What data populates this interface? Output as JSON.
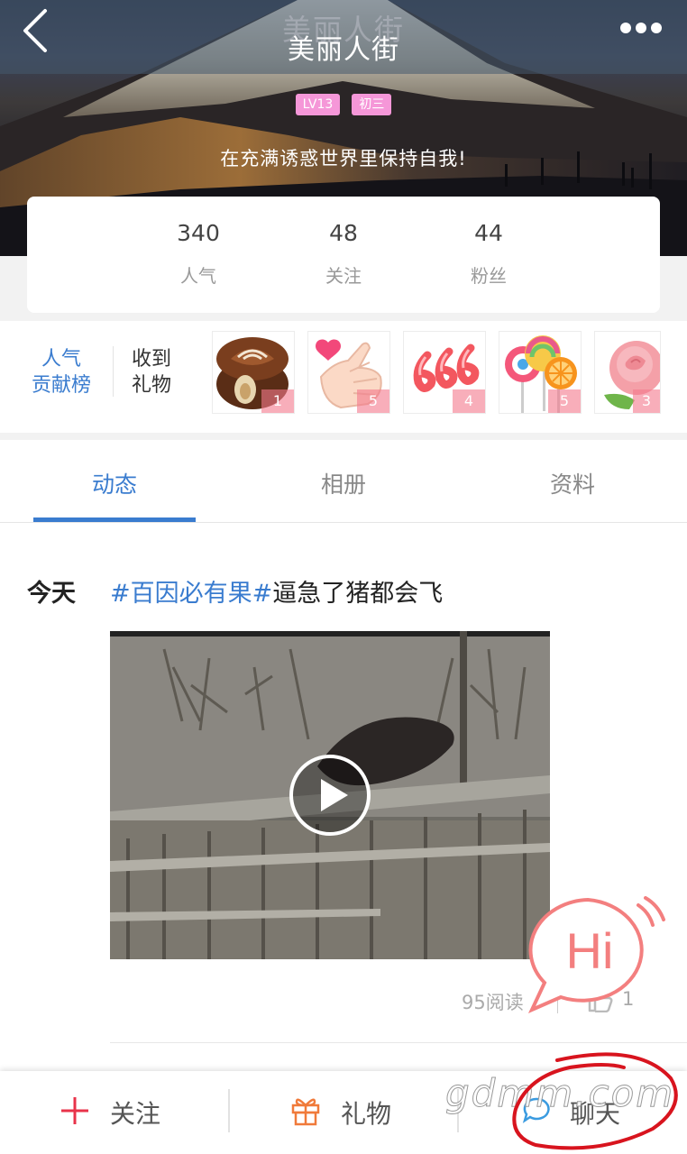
{
  "header": {
    "title": "美丽人街",
    "title_ghost": "美丽人街",
    "badges": [
      "LV13",
      "初三"
    ],
    "motto": "在充满诱惑世界里保持自我!",
    "back_icon": "chevron-left-icon",
    "more_icon": "more-dots-icon"
  },
  "stats": [
    {
      "value": "340",
      "label": "人气"
    },
    {
      "value": "48",
      "label": "关注"
    },
    {
      "value": "44",
      "label": "粉丝"
    }
  ],
  "gifts": {
    "rank_link": "人气贡献榜",
    "rank_line1": "人气",
    "rank_line2": "贡献榜",
    "received_line1": "收到",
    "received_line2": "礼物",
    "items": [
      {
        "icon": "chocolate-icon",
        "count": "1"
      },
      {
        "icon": "heart-hand-icon",
        "count": "5"
      },
      {
        "icon": "666-balloon-icon",
        "count": "4"
      },
      {
        "icon": "lollipop-icon",
        "count": "5"
      },
      {
        "icon": "rose-icon",
        "count": "3"
      }
    ]
  },
  "tabs": [
    {
      "label": "动态",
      "active": true
    },
    {
      "label": "相册",
      "active": false
    },
    {
      "label": "资料",
      "active": false
    }
  ],
  "post": {
    "date": "今天",
    "hashtag": "#百因必有果#",
    "text": "逼急了猪都会飞",
    "reads": "95阅读",
    "likes": "1"
  },
  "hi_bubble": "Hi",
  "bottom_bar": {
    "follow": "关注",
    "gift": "礼物",
    "chat": "聊天"
  },
  "watermark": "gdmm.com",
  "colors": {
    "accent": "#3a7ccf",
    "badge": "#f597d8",
    "follow_red": "#e8334a",
    "gift_orange": "#f07a3a",
    "hi_pink": "#f37f7f"
  }
}
